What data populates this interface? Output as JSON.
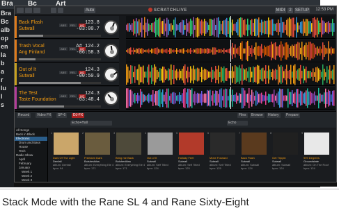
{
  "background_window": {
    "title_fragments": [
      "Bra",
      "Bc",
      "Art"
    ],
    "left_rows": [
      "Bra",
      "Bc",
      "alb",
      "op",
      "en",
      "la",
      "b",
      "a",
      "r",
      "lu",
      "l",
      "s"
    ]
  },
  "app": {
    "topbar": {
      "left_buttons": [
        "",
        "",
        "",
        "",
        "",
        "Auto"
      ],
      "logo": "SCRATCHLIVE",
      "right_buttons": [
        "MIDI",
        "2",
        "SETUP"
      ],
      "clock": "12:53 PM"
    },
    "decks": [
      {
        "title": "Back Flash",
        "artist": "Sutwall",
        "bpm": "123.8",
        "time": "-03:00.7",
        "color": "#e07b1a",
        "progress": 0.3,
        "deck_label": "USB 1"
      },
      {
        "title": "Trash Vocal",
        "artist": "Ang Finland",
        "bpm": "A# 124.2",
        "time": "-06:58.3",
        "color": "#e07b1a",
        "progress": 0.2,
        "deck_label": "USB 2"
      },
      {
        "title": "Out of It",
        "artist": "Sutwall",
        "bpm": "124.3",
        "time": "-00:50.9",
        "color": "#c9a21e",
        "progress": 0.75,
        "deck_label": "USB 3"
      },
      {
        "title": "The Test",
        "artist": "Taste Foundation",
        "bpm": "124.3",
        "time": "-03:48.4",
        "color": "#b53c9b",
        "progress": 0.55,
        "deck_label": "USB 4"
      }
    ],
    "deck_buttons": [
      "ABS",
      "REL",
      "INT"
    ],
    "controls": {
      "left": [
        "Record",
        "Video FX",
        "SP-6",
        "DJ-FX"
      ],
      "fx_left": "Echo+Hall",
      "fx_right": "Echo",
      "right": [
        "Files",
        "Browse",
        "History",
        "Prepare"
      ]
    },
    "tree": [
      {
        "label": "All Songs",
        "level": 0,
        "selected": false
      },
      {
        "label": "Back in Black",
        "level": 0,
        "selected": false
      },
      {
        "label": "Electronic",
        "level": 0,
        "selected": true
      },
      {
        "label": "Drum and Bass",
        "level": 1,
        "selected": false
      },
      {
        "label": "House",
        "level": 1,
        "selected": false
      },
      {
        "label": "Tech",
        "level": 1,
        "selected": false
      },
      {
        "label": "Radio Show",
        "level": 0,
        "selected": false
      },
      {
        "label": "April",
        "level": 1,
        "selected": false
      },
      {
        "label": "February",
        "level": 1,
        "selected": false
      },
      {
        "label": "January",
        "level": 1,
        "selected": false
      },
      {
        "label": "Week 1",
        "level": 2,
        "selected": false
      },
      {
        "label": "Week 2",
        "level": 2,
        "selected": false
      },
      {
        "label": "Week 3",
        "level": 2,
        "selected": false
      }
    ],
    "albums": [
      {
        "num": "1",
        "title": "Dark Of The Light",
        "artist": "Denfall",
        "album": "album: Denfall",
        "meta": "bpm: 94",
        "art_color": "#caa66a"
      },
      {
        "num": "2",
        "title": "Freedom Dark",
        "artist": "Bolshevikiss",
        "album": "album: Everything Ele 4",
        "meta": "bpm: 171",
        "art_color": "#6a5c3e"
      },
      {
        "num": "3",
        "title": "Bring me Back",
        "artist": "Bolshevikiss",
        "album": "album: Everything Ele 4",
        "meta": "bpm: 171",
        "art_color": "#4e4a3a"
      },
      {
        "num": "4",
        "title": "Out of It",
        "artist": "Sutwall",
        "album": "album: Self Titled",
        "meta": "bpm: 124",
        "art_color": "#9a9a9a"
      },
      {
        "num": "5",
        "title": "Holiday Feet",
        "artist": "Sutwall",
        "album": "album: Self Titled",
        "meta": "bpm: 125",
        "art_color": "#b23a2a"
      },
      {
        "num": "6",
        "title": "Move Forward",
        "artist": "Sutwall",
        "album": "album: Self Titled",
        "meta": "bpm: 125",
        "art_color": "#2a2a2a"
      },
      {
        "num": "7",
        "title": "Back Flash",
        "artist": "Sutwall",
        "album": "album: Sutwall",
        "meta": "bpm: 124",
        "art_color": "#5a3a1e"
      },
      {
        "num": "8",
        "title": "Get Trippin",
        "artist": "Sutwall",
        "album": "album: Sutwall",
        "meta": "bpm: 124",
        "art_color": "#202020"
      },
      {
        "num": "9",
        "title": "999 Degrees",
        "artist": "Groundstate",
        "album": "album: On The Roof",
        "meta": "bpm: 124",
        "art_color": "#e8e8e8"
      }
    ],
    "bottom_left": "Album Art",
    "bottom_right": "1:00:00"
  },
  "caption": "Stack Mode with the Rane SL 4 and Rane Sixty-Eight"
}
